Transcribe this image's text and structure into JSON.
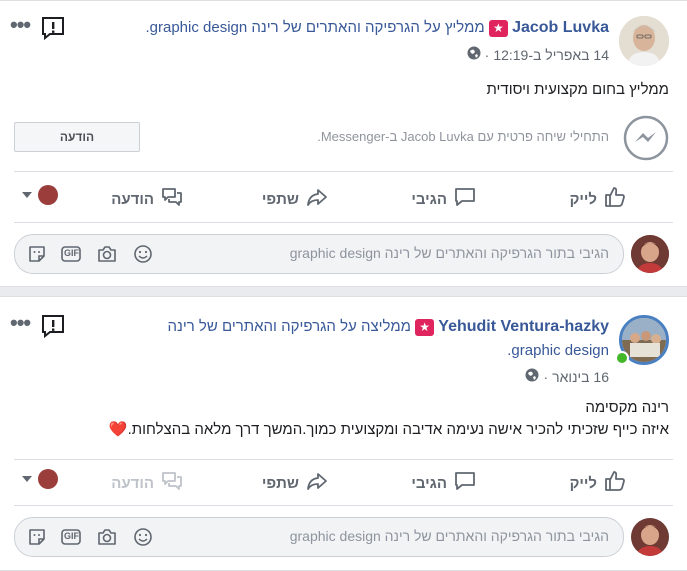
{
  "posts": [
    {
      "author": "Jacob Luvka",
      "rec_text": "ממליץ על הגרפיקה והאתרים של רינה graphic design.",
      "date": "14 באפריל ב-12:19",
      "body": "ממליץ בחום מקצועית ויסודית",
      "messenger_prompt": "התחילי שיחה פרטית עם Jacob Luvka ב-Messenger.",
      "message_button": "הודעה",
      "actions": {
        "like": "לייק",
        "comment": "הגיבי",
        "share": "שתפי",
        "message": "הודעה"
      },
      "comment_placeholder": "הגיבי בתור הגרפיקה והאתרים של רינה graphic design"
    },
    {
      "author": "Yehudit Ventura-hazky",
      "rec_line1": "ממליצה על הגרפיקה והאתרים של רינה",
      "rec_line2": "graphic design.",
      "date": "16 בינואר",
      "body_line1": "רינה מקסימה",
      "body_line2": "איזה כייף שזכיתי להכיר אישה נעימה אדיבה ומקצועית כמוך.המשך דרך מלאה בהצלחות.",
      "heart": "❤️",
      "actions": {
        "like": "לייק",
        "comment": "הגיבי",
        "share": "שתפי",
        "message": "הודעה"
      },
      "comment_placeholder": "הגיבי בתור הגרפיקה והאתרים של רינה graphic design"
    }
  ],
  "comment_icons": {
    "gif_label": "GIF"
  },
  "colors": {
    "link": "#385898",
    "badge": "#e0245e",
    "like_blue": "#606770",
    "heart": "#e0245e"
  }
}
